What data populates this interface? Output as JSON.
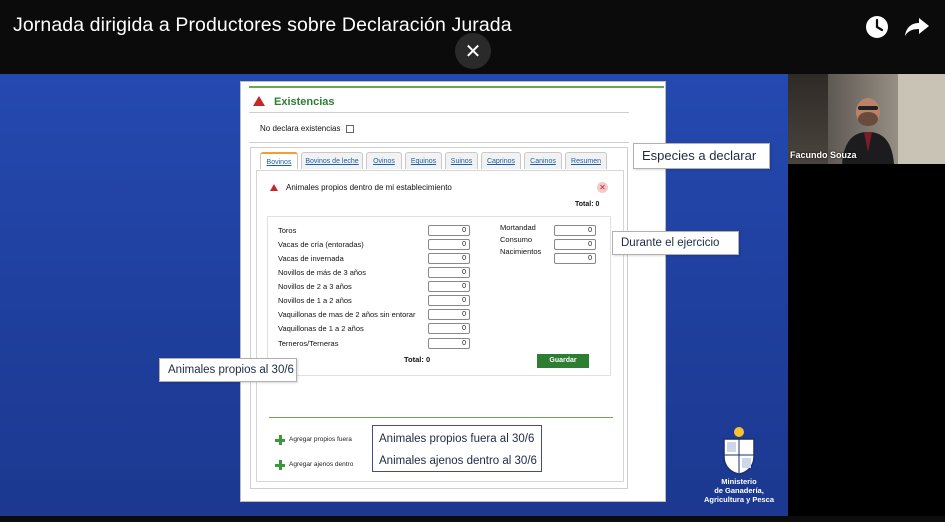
{
  "video": {
    "title": "Jornada dirigida a Productores sobre Declaración Jurada",
    "close_glyph": "✕"
  },
  "icons": {
    "close": "close-icon",
    "watch_later": "clock-icon",
    "share": "share-arrow-icon",
    "ministry": "ministry-seal-icon"
  },
  "webcam": {
    "name": "Facundo Souza"
  },
  "form": {
    "section_title": "Existencias",
    "no_declara_label": "No declara existencias",
    "tabs": [
      "Bovinos",
      "Bovinos de leche",
      "Ovinos",
      "Equinos",
      "Suinos",
      "Caprinos",
      "Caninos",
      "Resumen"
    ],
    "active_tab": "Bovinos",
    "subsection_title": "Animales propios dentro de mi establecimiento",
    "subsection_close": "✕",
    "total_top": "Total: 0",
    "categories": [
      {
        "label": "Toros",
        "value": "0"
      },
      {
        "label": "Vacas de cría (entoradas)",
        "value": "0"
      },
      {
        "label": "Vacas de invernada",
        "value": "0"
      },
      {
        "label": "Novillos de más de 3 años",
        "value": "0"
      },
      {
        "label": "Novillos de 2 a 3 años",
        "value": "0"
      },
      {
        "label": "Novillos de 1 a 2 años",
        "value": "0"
      },
      {
        "label": "Vaquillonas de mas de 2 años sin entorar",
        "value": "0"
      },
      {
        "label": "Vaquillonas de 1 a 2 años",
        "value": "0"
      },
      {
        "label": "Terneros/Terneras",
        "value": "0"
      }
    ],
    "movements": [
      {
        "label": "Mortandad",
        "value": "0"
      },
      {
        "label": "Consumo",
        "value": "0"
      },
      {
        "label": "Nacimientos",
        "value": "0"
      }
    ],
    "total_bottom": "Total: 0",
    "save_label": "Guardar",
    "add_fuera_label": "Agregar propios fuera",
    "add_ajenos_label": "Agregar ajenos dentro"
  },
  "callouts": {
    "especies": "Especies a declarar",
    "ejercicio": "Durante el ejercicio",
    "propios_306": "Animales propios al 30/6",
    "propios_fuera": "Animales propios fuera al 30/6",
    "ajenos_dentro": "Animales ajenos dentro al 30/6"
  },
  "ministry": {
    "line1": "Ministerio",
    "line2": "de Ganadería,",
    "line3": "Agricultura y Pesca"
  },
  "colors": {
    "slide_bg": "#2145a8",
    "accent_green": "#2e7d32",
    "alert_red": "#c62828",
    "link_blue": "#1a5ea8"
  }
}
